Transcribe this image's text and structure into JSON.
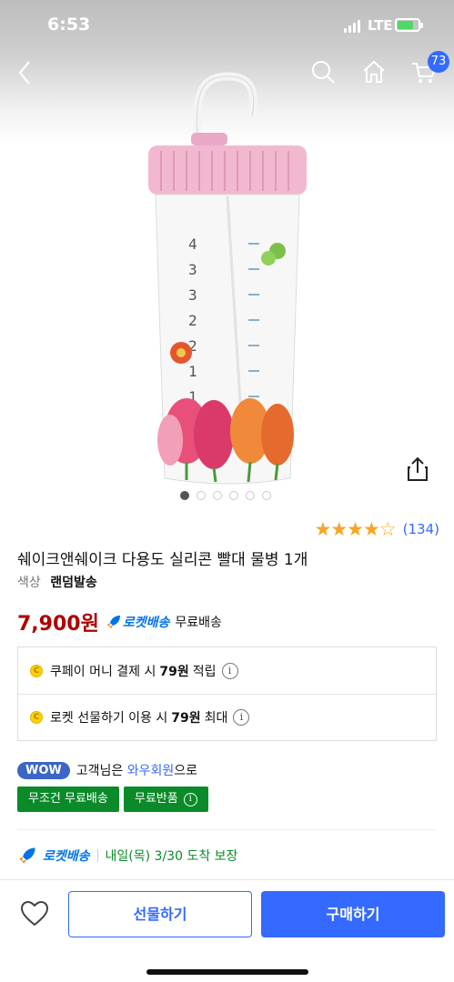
{
  "status": {
    "time": "6:53",
    "network": "LTE"
  },
  "nav": {
    "cart_count": "73"
  },
  "gallery": {
    "total": 6,
    "active": 0
  },
  "rating": {
    "stars": "★★★★☆",
    "count": "(134)",
    "value": 4.5
  },
  "product": {
    "title": "쉐이크앤쉐이크 다용도 실리콘 빨대 물병 1개",
    "option_label": "색상",
    "option_value": "랜덤발송"
  },
  "price": {
    "amount": "7,900원",
    "rocket_label": "로켓배송",
    "shipping": "무료배송"
  },
  "benefits": [
    {
      "before": "쿠페이 머니 결제 시",
      "amount": "79원",
      "after": "적립"
    },
    {
      "before": "로켓 선물하기 이용 시",
      "amount": "79원",
      "after": "최대"
    }
  ],
  "wow": {
    "badge": "WOW",
    "prefix": "고객님은",
    "link": "와우회원",
    "suffix": "으로",
    "tags": [
      "무조건 무료배송",
      "무료반품"
    ]
  },
  "delivery": {
    "label": "로켓배송",
    "eta": "내일(목) 3/30 도착 보장"
  },
  "actions": {
    "gift_label": "선물하기",
    "buy_label": "구매하기"
  },
  "colors": {
    "accent": "#346aff",
    "price": "#ae0000",
    "green": "#0a8a28",
    "star": "#f5a623"
  }
}
